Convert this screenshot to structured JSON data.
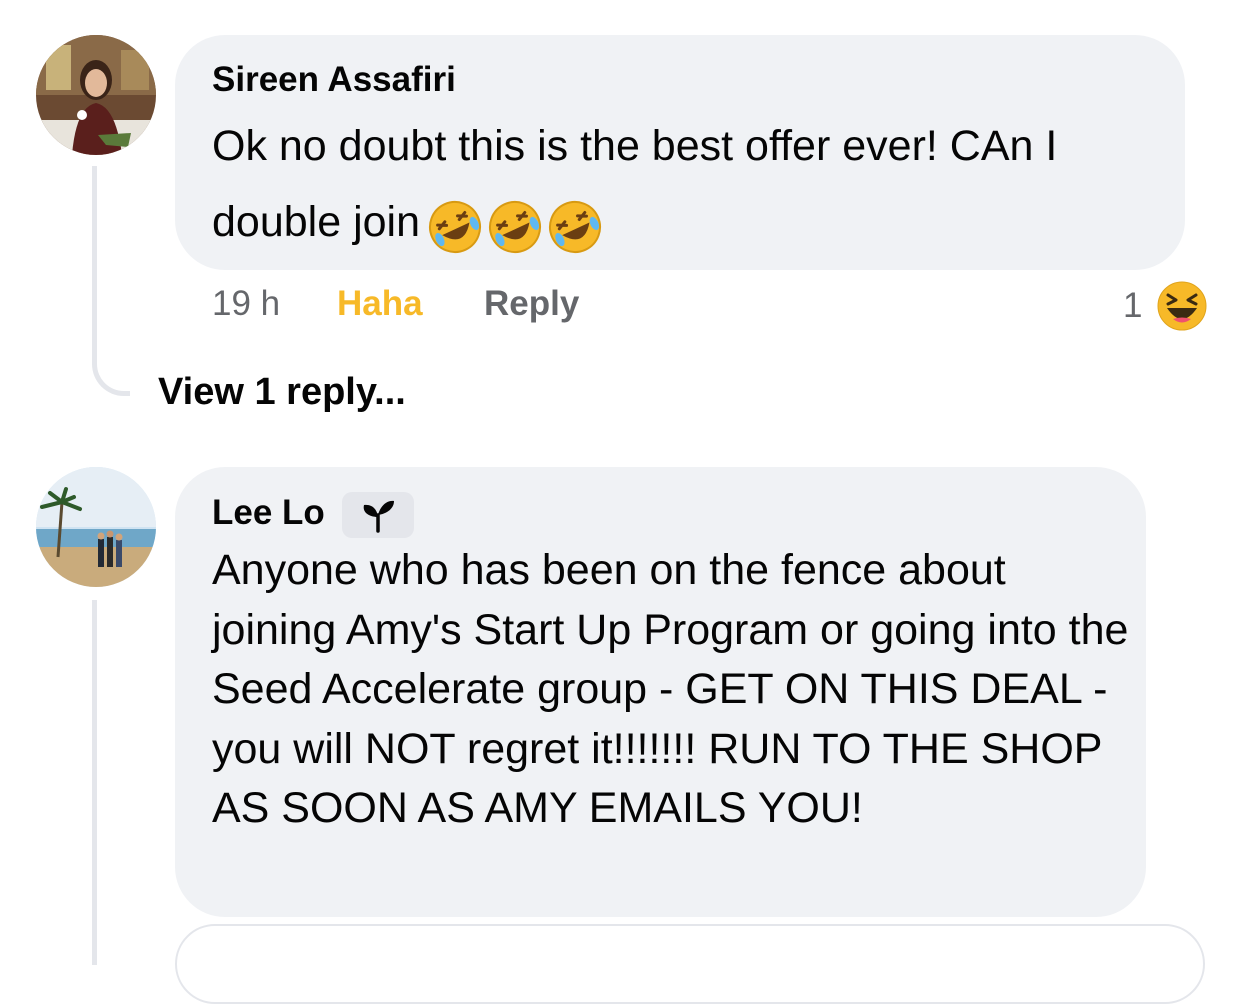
{
  "colors": {
    "bubble": "#f0f2f5",
    "secondary_text": "#65676b",
    "haha_reaction": "#f7b928",
    "thread_line": "#e4e6eb"
  },
  "comments": [
    {
      "author": "Sireen Assafiri",
      "text": "Ok no doubt this is the best offer ever! CAn I double join",
      "trailing_icons": [
        "rolling-on-floor-laughing-emoji",
        "rolling-on-floor-laughing-emoji",
        "rolling-on-floor-laughing-emoji"
      ],
      "time": "19 h",
      "reaction_label": "Haha",
      "reply_label": "Reply",
      "reaction_count": "1",
      "reaction_icon": "laughing-face-emoji",
      "view_replies": "View 1 reply..."
    },
    {
      "author": "Lee Lo",
      "badge_icon": "sprout-icon",
      "text": "Anyone who has been on the fence about joining Amy's Start Up Program or going into the Seed Accelerate group - GET ON THIS DEAL - you will NOT regret it!!!!!!! RUN TO THE SHOP AS SOON AS AMY EMAILS YOU!"
    }
  ]
}
